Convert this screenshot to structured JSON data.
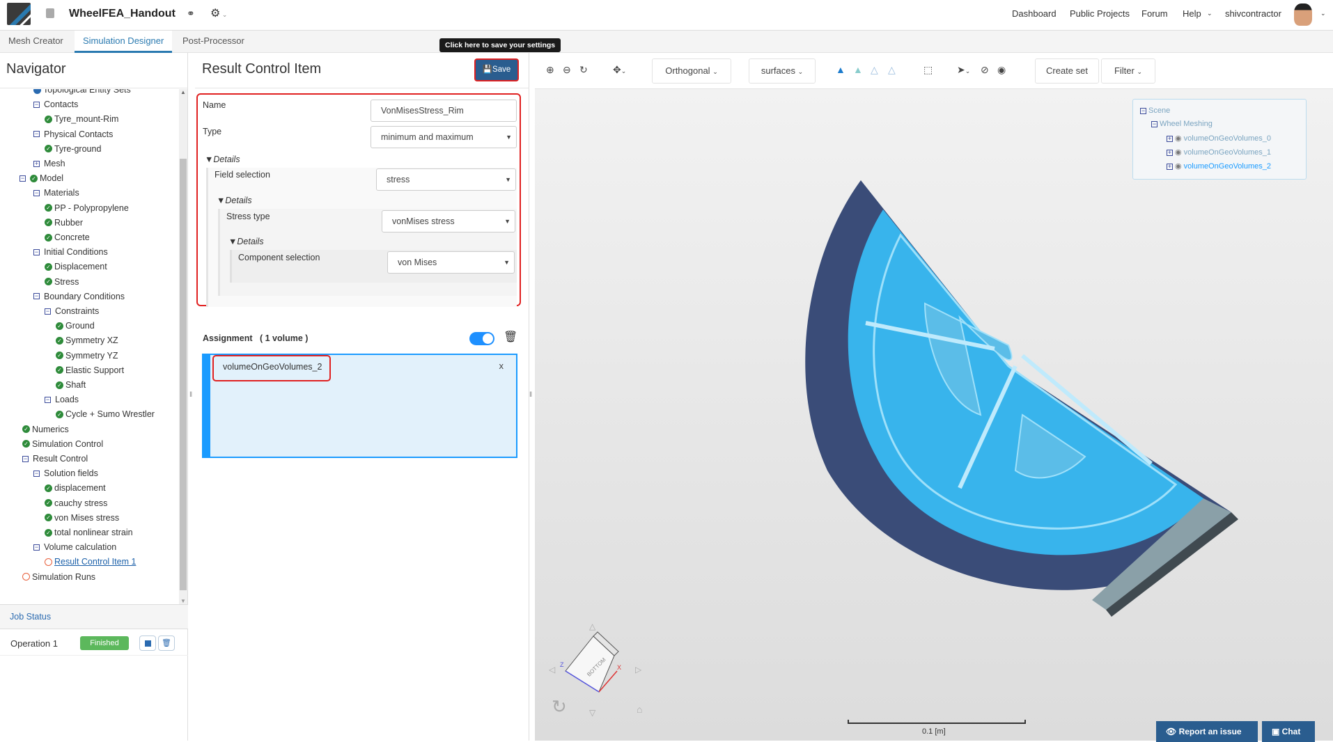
{
  "header": {
    "project_title": "WheelFEA_Handout",
    "nav_links": [
      "Dashboard",
      "Public Projects",
      "Forum",
      "Help"
    ],
    "username": "shivcontractor"
  },
  "tabs": [
    "Mesh Creator",
    "Simulation Designer",
    "Post-Processor"
  ],
  "tooltip": "Click here to save your settings",
  "navigator": {
    "title": "Navigator",
    "items": [
      {
        "label": "Topological Entity Sets",
        "level": 2,
        "icon": "dot"
      },
      {
        "label": "Contacts",
        "level": 2,
        "icon": "minus"
      },
      {
        "label": "Tyre_mount-Rim",
        "level": 3,
        "icon": "check"
      },
      {
        "label": "Physical Contacts",
        "level": 2,
        "icon": "minus"
      },
      {
        "label": "Tyre-ground",
        "level": 3,
        "icon": "check"
      },
      {
        "label": "Mesh",
        "level": 2,
        "icon": "plus"
      },
      {
        "label": "Model",
        "level": 1,
        "icon": "minus-check"
      },
      {
        "label": "Materials",
        "level": 2,
        "icon": "minus"
      },
      {
        "label": "PP - Polypropylene",
        "level": 3,
        "icon": "check"
      },
      {
        "label": "Rubber",
        "level": 3,
        "icon": "check"
      },
      {
        "label": "Concrete",
        "level": 3,
        "icon": "check"
      },
      {
        "label": "Initial Conditions",
        "level": 2,
        "icon": "minus"
      },
      {
        "label": "Displacement",
        "level": 3,
        "icon": "check"
      },
      {
        "label": "Stress",
        "level": 3,
        "icon": "check"
      },
      {
        "label": "Boundary Conditions",
        "level": 2,
        "icon": "minus"
      },
      {
        "label": "Constraints",
        "level": 3,
        "icon": "minus"
      },
      {
        "label": "Ground",
        "level": 4,
        "icon": "check"
      },
      {
        "label": "Symmetry XZ",
        "level": 4,
        "icon": "check"
      },
      {
        "label": "Symmetry YZ",
        "level": 4,
        "icon": "check"
      },
      {
        "label": "Elastic Support",
        "level": 4,
        "icon": "check"
      },
      {
        "label": "Shaft",
        "level": 4,
        "icon": "check"
      },
      {
        "label": "Loads",
        "level": 3,
        "icon": "minus"
      },
      {
        "label": "Cycle + Sumo Wrestler",
        "level": 4,
        "icon": "check"
      },
      {
        "label": "Numerics",
        "level": 1,
        "icon": "check"
      },
      {
        "label": "Simulation Control",
        "level": 1,
        "icon": "check"
      },
      {
        "label": "Result Control",
        "level": 1,
        "icon": "minus"
      },
      {
        "label": "Solution fields",
        "level": 2,
        "icon": "minus"
      },
      {
        "label": "displacement",
        "level": 3,
        "icon": "check"
      },
      {
        "label": "cauchy stress",
        "level": 3,
        "icon": "check"
      },
      {
        "label": "von Mises stress",
        "level": 3,
        "icon": "check"
      },
      {
        "label": "total nonlinear strain",
        "level": 3,
        "icon": "check"
      },
      {
        "label": "Volume calculation",
        "level": 2,
        "icon": "minus"
      },
      {
        "label": "Result Control Item 1",
        "level": 3,
        "icon": "circle",
        "link": true
      },
      {
        "label": "Simulation Runs",
        "level": 1,
        "icon": "circle"
      }
    ]
  },
  "job_status": {
    "title": "Job Status",
    "operation": "Operation 1",
    "status": "Finished",
    "status_color": "#5cb85c"
  },
  "form": {
    "title": "Result Control Item",
    "save_label": "Save",
    "name_label": "Name",
    "name_value": "VonMisesStress_Rim",
    "type_label": "Type",
    "type_value": "minimum and maximum",
    "details_label": "Details",
    "field_label": "Field selection",
    "field_value": "stress",
    "stress_type_label": "Stress type",
    "stress_type_value": "vonMises stress",
    "component_label": "Component selection",
    "component_value": "von Mises",
    "assignment_label": "Assignment",
    "assignment_count": "( 1 volume )",
    "assignment_enabled": true,
    "assigned_item": "volumeOnGeoVolumes_2",
    "remove": "x"
  },
  "viewer": {
    "projection": "Orthogonal",
    "render_mode": "surfaces",
    "create_set": "Create set",
    "filter": "Filter",
    "scene_tree": {
      "root": "Scene",
      "child": "Wheel Meshing",
      "volumes": [
        "volumeOnGeoVolumes_0",
        "volumeOnGeoVolumes_1",
        "volumeOnGeoVolumes_2"
      ]
    },
    "cube_label": "BOTTOM",
    "scale_label": "0.1 [m]",
    "report": "Report an issue",
    "chat": "Chat"
  }
}
